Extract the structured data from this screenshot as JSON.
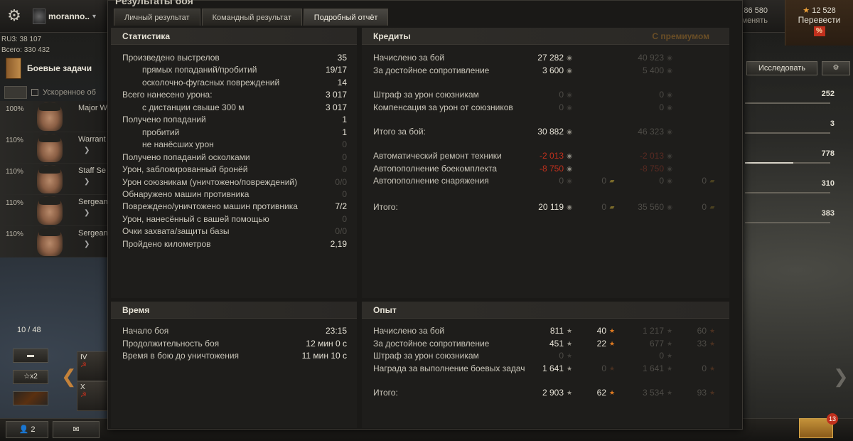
{
  "topbar": {
    "player_name": "moranno..",
    "rating_line1": "RU3: 38 107",
    "rating_line2": "Всего: 330 432",
    "gold_value": "86 580",
    "gold_sub": "Обменять",
    "free_xp_value": "12 528",
    "free_xp_label": "Перевести",
    "free_xp_badge": "%"
  },
  "left": {
    "missions_label": "Боевые задачи",
    "accel_label": "Ускоренное об",
    "crew": [
      {
        "pct": "100%",
        "rank": "Major W"
      },
      {
        "pct": "110%",
        "rank": "Warrant"
      },
      {
        "pct": "110%",
        "rank": "Staff Se"
      },
      {
        "pct": "110%",
        "rank": "Sergean"
      },
      {
        "pct": "110%",
        "rank": "Sergean"
      }
    ],
    "tank_count": "10 / 48",
    "btn_x2": "☆x2",
    "slot1_tier": "IV",
    "slot2_tier": "X",
    "bb_platoon": "2"
  },
  "right": {
    "research_label": "Исследовать",
    "params": [
      "252",
      "3",
      "778",
      "310",
      "383"
    ]
  },
  "dialog": {
    "title": "Результаты боя",
    "tabs": [
      "Личный результат",
      "Командный результат",
      "Подробный отчёт"
    ],
    "statistics": {
      "title": "Статистика",
      "rows": [
        {
          "label": "Произведено выстрелов",
          "value": "35"
        },
        {
          "label": "прямых попаданий/пробитий",
          "value": "19/17"
        },
        {
          "label": "осколочно-фугасных повреждений",
          "value": "14"
        },
        {
          "label": "Всего нанесено урона:",
          "value": "3 017"
        },
        {
          "label": "с дистанции свыше 300 м",
          "value": "3 017"
        },
        {
          "label": "Получено попаданий",
          "value": "1"
        },
        {
          "label": "пробитий",
          "value": "1"
        },
        {
          "label": "не нанёсших урон",
          "value": "0"
        },
        {
          "label": "Получено попаданий осколками",
          "value": "0"
        },
        {
          "label": "Урон, заблокированный бронёй",
          "value": "0"
        },
        {
          "label": "Урон союзникам (уничтожено/повреждений)",
          "value": "0/0"
        },
        {
          "label": "Обнаружено машин противника",
          "value": "0"
        },
        {
          "label": "Повреждено/уничтожено машин противника",
          "value": "7/2"
        },
        {
          "label": "Урон, нанесённый с вашей помощью",
          "value": "0"
        },
        {
          "label": "Очки захвата/защиты базы",
          "value": "0/0"
        },
        {
          "label": "Пройдено километров",
          "value": "2,19"
        }
      ]
    },
    "credits": {
      "title": "Кредиты",
      "premium_label": "С премиумом",
      "rows": [
        {
          "label": "Начислено за бой",
          "value": "27 282",
          "prem": "40 923"
        },
        {
          "label": "За достойное сопротивление",
          "value": "3 600",
          "prem": "5 400"
        },
        {
          "label": "Штраф за урон союзникам",
          "value": "0",
          "prem": "0"
        },
        {
          "label": "Компенсация за урон от союзников",
          "value": "0",
          "prem": "0"
        },
        {
          "label": "Итого за бой:",
          "value": "30 882",
          "prem": "46 323"
        },
        {
          "label": "Автоматический ремонт техники",
          "value": "-2 013",
          "prem": "-2 013"
        },
        {
          "label": "Автопополнение боекомплекта",
          "value": "-8 750",
          "prem": "-8 750"
        },
        {
          "label": "Автопополнение снаряжения",
          "value": "0",
          "gold": "0",
          "prem": "0",
          "prem_gold": "0"
        },
        {
          "label": "Итого:",
          "value": "20 119",
          "gold": "0",
          "prem": "35 560",
          "prem_gold": "0"
        }
      ]
    },
    "time": {
      "title": "Время",
      "rows": [
        {
          "label": "Начало боя",
          "value": "23:15"
        },
        {
          "label": "Продолжительность боя",
          "value": "12 мин 0 с"
        },
        {
          "label": "Время в бою до уничтожения",
          "value": "11 мин 10 с"
        }
      ]
    },
    "experience": {
      "title": "Опыт",
      "rows": [
        {
          "label": "Начислено за бой",
          "xp": "811",
          "fxp": "40",
          "pxp": "1 217",
          "pfxp": "60"
        },
        {
          "label": "За достойное сопротивление",
          "xp": "451",
          "fxp": "22",
          "pxp": "677",
          "pfxp": "33"
        },
        {
          "label": "Штраф за урон союзникам",
          "xp": "0",
          "fxp": "",
          "pxp": "0",
          "pfxp": ""
        },
        {
          "label": "Награда за выполнение боевых задач",
          "xp": "1 641",
          "fxp": "0",
          "pxp": "1 641",
          "pfxp": "0"
        },
        {
          "label": "Итого:",
          "xp": "2 903",
          "fxp": "62",
          "pxp": "3 534",
          "pfxp": "93"
        }
      ]
    }
  }
}
